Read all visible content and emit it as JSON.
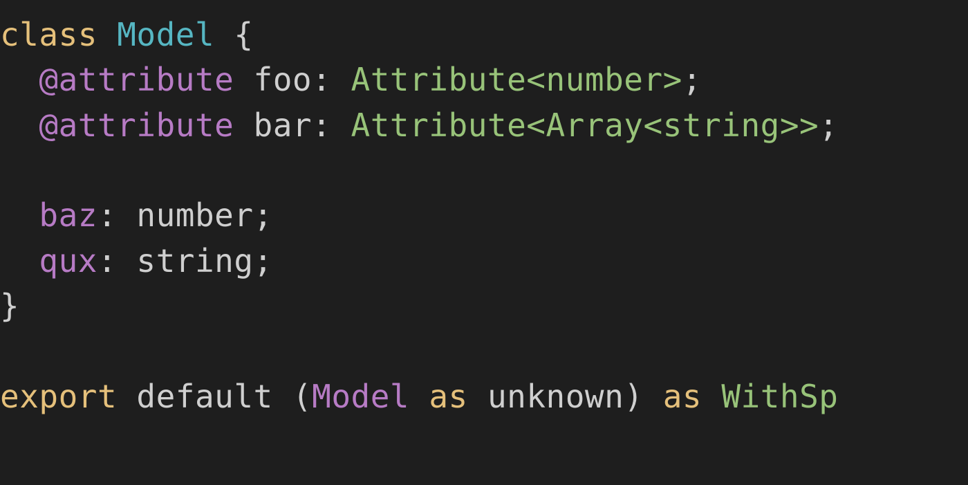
{
  "code": {
    "line1": {
      "t1": "class",
      "t2": " ",
      "t3": "Model",
      "t4": " ",
      "t5": "{"
    },
    "line2": {
      "t1": "  ",
      "t2": "@attribute",
      "t3": " ",
      "t4": "foo",
      "t5": ": ",
      "t6": "Attribute",
      "t7": "<",
      "t8": "number",
      "t9": ">",
      "t10": ";"
    },
    "line3": {
      "t1": "  ",
      "t2": "@attribute",
      "t3": " ",
      "t4": "bar",
      "t5": ": ",
      "t6": "Attribute",
      "t7": "<",
      "t8": "Array",
      "t9": "<",
      "t10": "string",
      "t11": ">>",
      "t12": ";"
    },
    "line4": {
      "t1": " "
    },
    "line5": {
      "t1": "  ",
      "t2": "baz",
      "t3": ": ",
      "t4": "number",
      "t5": ";"
    },
    "line6": {
      "t1": "  ",
      "t2": "qux",
      "t3": ": ",
      "t4": "string",
      "t5": ";"
    },
    "line7": {
      "t1": "}"
    },
    "line8": {
      "t1": " "
    },
    "line9": {
      "t1": "export",
      "t2": " ",
      "t3": "default",
      "t4": " ",
      "t5": "(",
      "t6": "Model",
      "t7": " ",
      "t8": "as",
      "t9": " ",
      "t10": "unknown",
      "t11": ")",
      "t12": " ",
      "t13": "as",
      "t14": " ",
      "t15": "WithSp"
    }
  }
}
